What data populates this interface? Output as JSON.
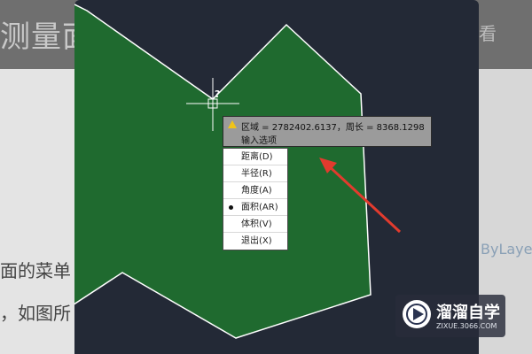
{
  "background": {
    "title": "测量面",
    "right_text": "看",
    "line1": "面的菜单",
    "line2": "，如图所",
    "bylayer": "ByLaye"
  },
  "tooltip": {
    "line1": "区域 = 2782402.6137，周长 = 8368.1298",
    "line2": "输入选项"
  },
  "menu": {
    "items": [
      "距离(D)",
      "半径(R)",
      "角度(A)",
      "面积(AR)",
      "体积(V)",
      "退出(X)"
    ],
    "selected": "面积(AR)"
  },
  "cursor": {
    "label": "?"
  },
  "watermark": {
    "title": "溜溜自学",
    "url": "ZIXUE.3066.COM"
  },
  "colors": {
    "canvas": "#232936",
    "shape_fill": "#1f6a2f",
    "shape_stroke": "#ffffff",
    "arrow": "#e23b2e"
  }
}
